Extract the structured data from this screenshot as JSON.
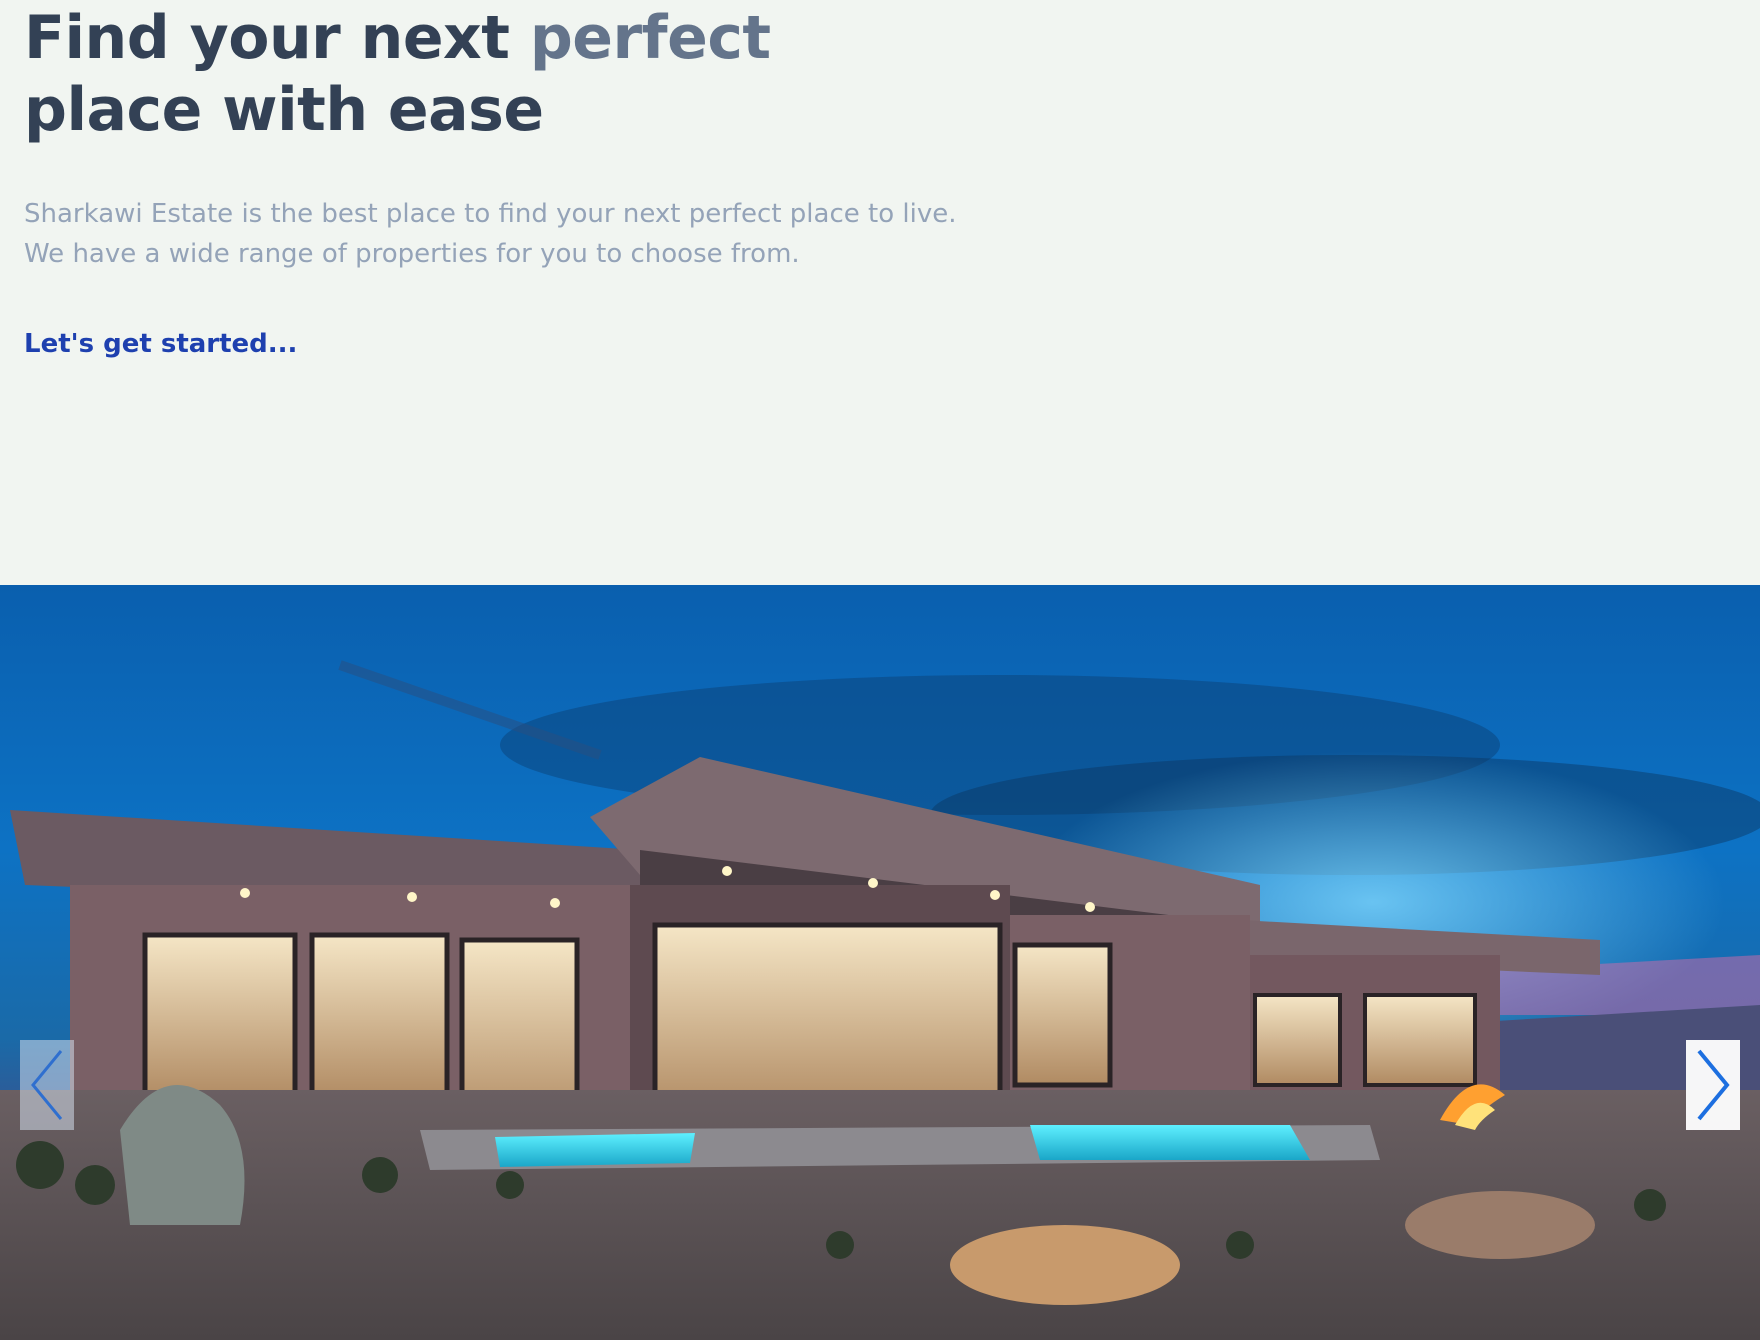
{
  "hero": {
    "headline_part1": "Find your next ",
    "headline_accent": "perfect",
    "headline_part2": "place with ease",
    "subtitle_line1": "Sharkawi Estate is the best place to find your next perfect place to live.",
    "subtitle_line2": "We have a wide range of properties for you to choose from.",
    "cta_label": "Let's get started..."
  },
  "slider": {
    "image_alt": "Modern home at dusk with pool and fire pit",
    "prev_icon": "chevron-left-icon",
    "next_icon": "chevron-right-icon"
  },
  "colors": {
    "background": "#f1f5f1",
    "headline": "#334155",
    "headline_accent": "#64748b",
    "subtitle": "#94a3b8",
    "cta": "#1e40af",
    "nav_arrow": "#1d6fe0"
  }
}
